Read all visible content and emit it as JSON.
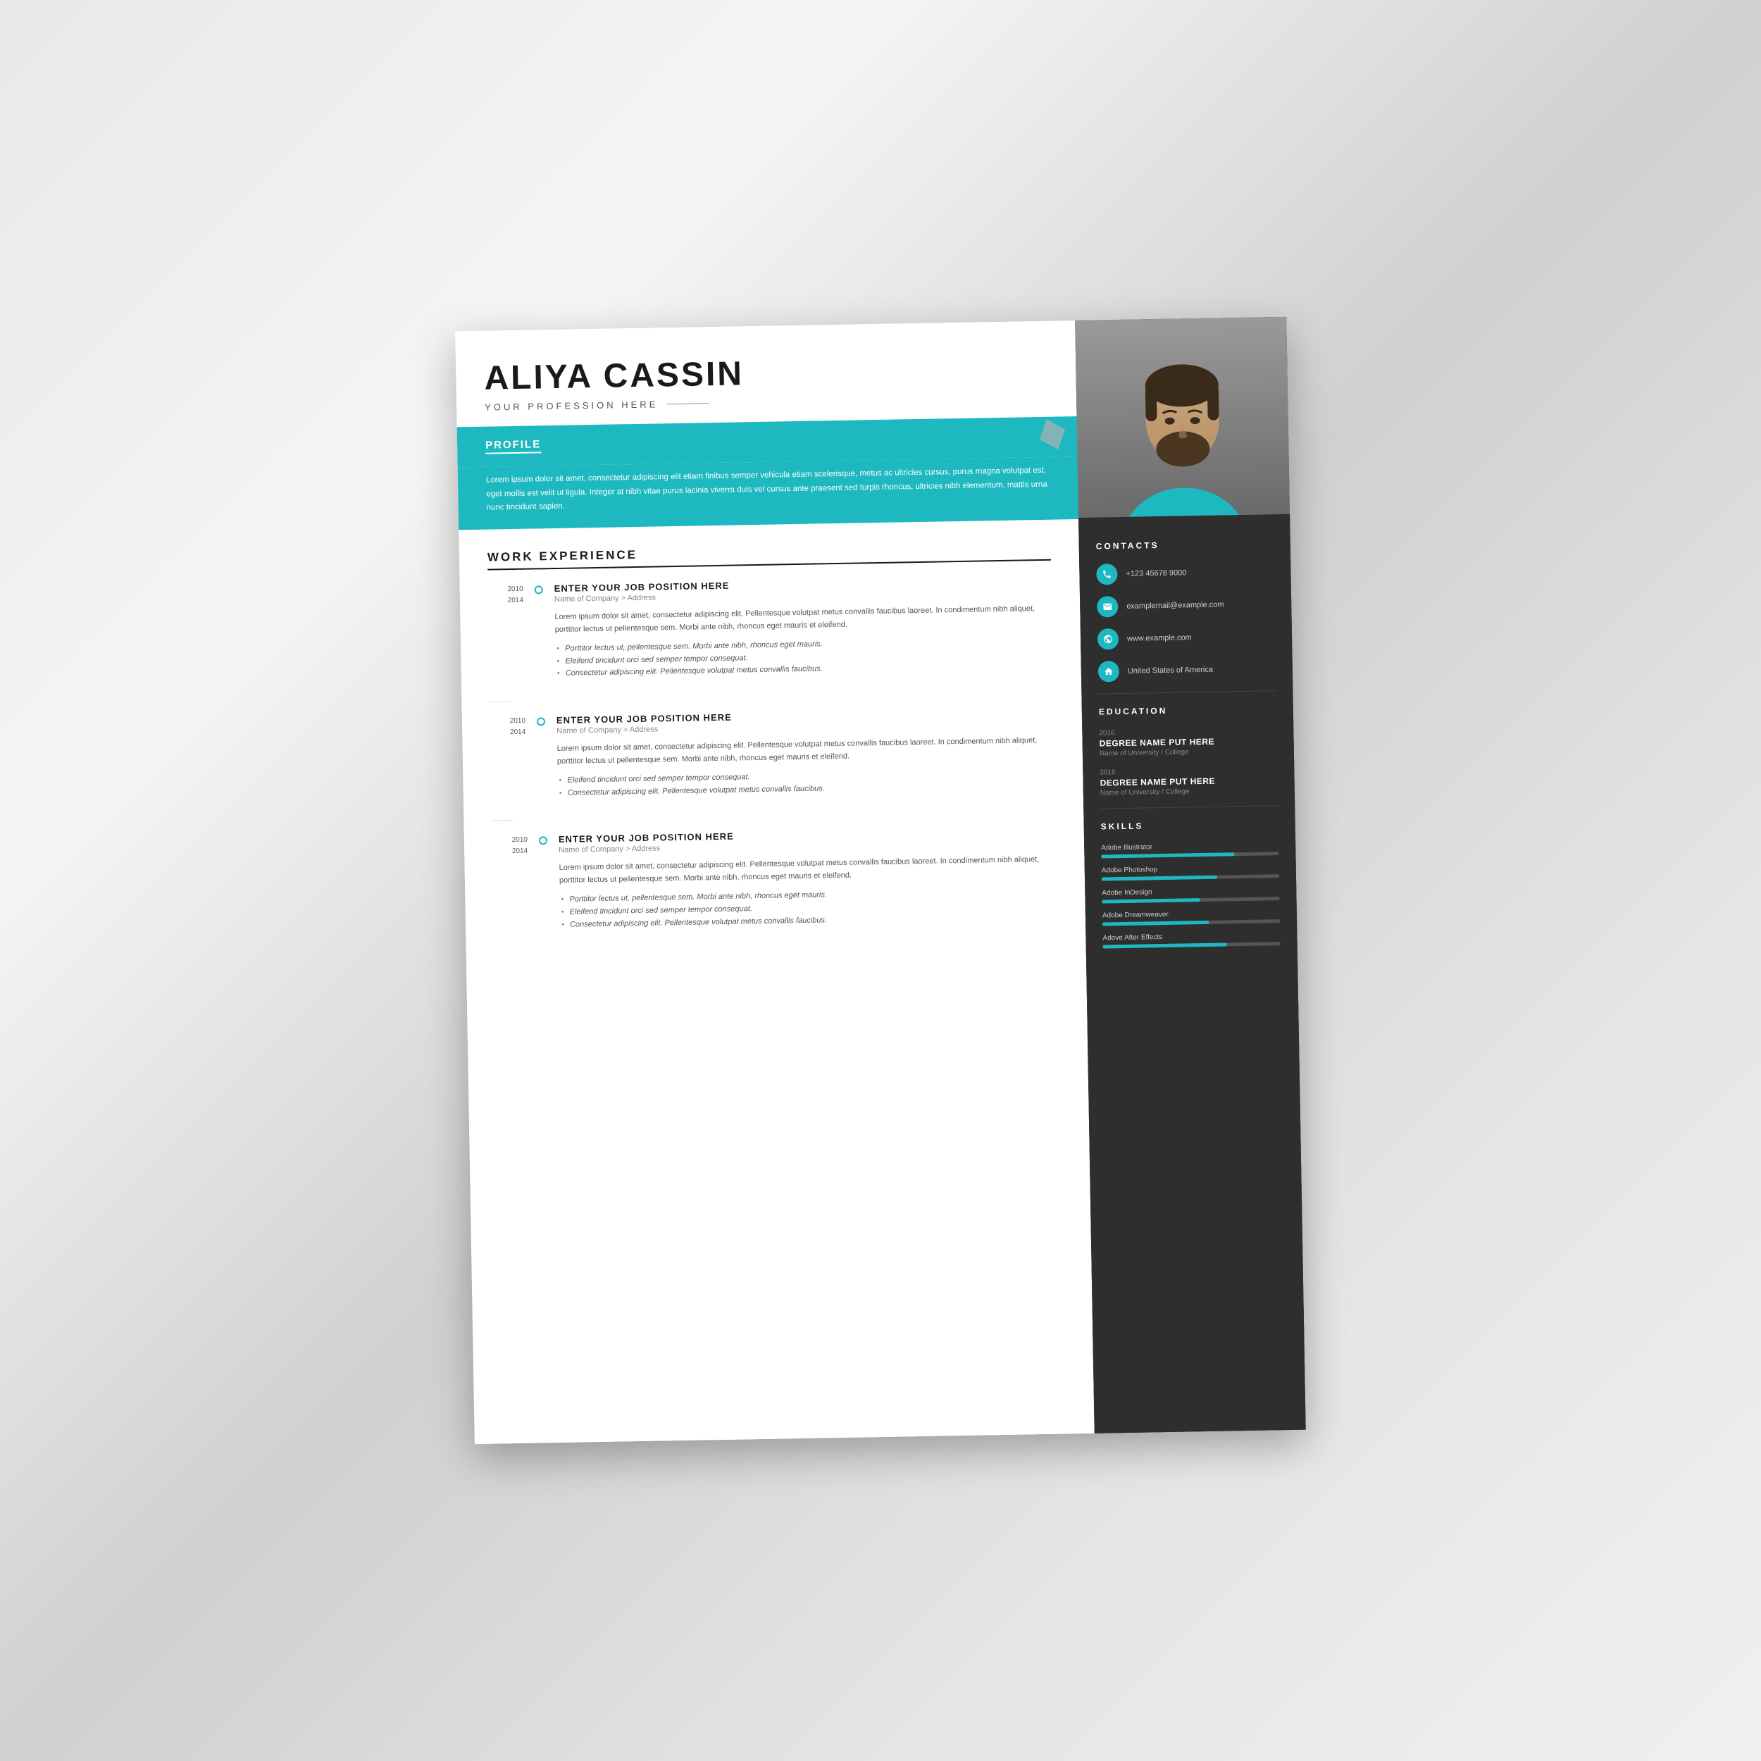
{
  "background": {
    "color": "#d8d8d8"
  },
  "resume": {
    "name": "ALIYA CASSIN",
    "profession": "YOUR PROFESSION HERE",
    "profile": {
      "label": "PROFILE",
      "text": "Lorem ipsum dolor sit amet, consectetur adipiscing elit etiam finibus semper vehicula etiam scelerisque, metus ac ultricies cursus, purus magna volutpat est, eget mollis est velit ut ligula. Integer at nibh vitae purus lacinia viverra duis vel cursus ante praesent sed turpis rhoncus, ultricies nibh elementum, mattis urna nunc tincidunt sapien."
    },
    "workExperience": {
      "sectionTitle": "WORK EXPERIENCE",
      "entries": [
        {
          "yearStart": "2010",
          "yearEnd": "2014",
          "jobTitle": "ENTER YOUR JOB POSITION HERE",
          "company": "Name of Company > Address",
          "description": "Lorem ipsum dolor sit amet, consectetur adipiscing elit. Pellentesque volutpat metus convallis faucibus laoreet. In condimentum nibh aliquet, porttitor lectus ut pellentesque sem. Morbi ante nibh, rhoncus eget mauris et eleifend.",
          "bullets": [
            "Porttitor lectus ut, pellentesque sem. Morbi ante nibh, rhoncus eget mauris.",
            "Eleifend tincidunt orci sed semper tempor consequat.",
            "Consectetur adipiscing elit. Pellentesque volutpat metus convallis faucibus."
          ]
        },
        {
          "yearStart": "2010",
          "yearEnd": "2014",
          "jobTitle": "ENTER YOUR JOB POSITION HERE",
          "company": "Name of Company > Address",
          "description": "Lorem ipsum dolor sit amet, consectetur adipiscing elit. Pellentesque volutpat metus convallis faucibus laoreet. In condimentum nibh aliquet, porttitor lectus ut pellentesque sem. Morbi ante nibh, rhoncus eget mauris et eleifend.",
          "bullets": [
            "Eleifend tincidunt orci sed semper tempor consequat.",
            "Consectetur adipiscing elit. Pellentesque volutpat metus convallis faucibus."
          ]
        },
        {
          "yearStart": "2010",
          "yearEnd": "2014",
          "jobTitle": "ENTER YOUR JOB POSITION HERE",
          "company": "Name of Company > Address",
          "description": "Lorem ipsum dolor sit amet, consectetur adipiscing elit. Pellentesque volutpat metus convallis faucibus laoreet. In condimentum nibh aliquet, porttitor lectus ut pellentesque sem. Morbi ante nibh, rhoncus eget mauris et eleifend.",
          "bullets": [
            "Porttitor lectus ut, pellentesque sem. Morbi ante nibh, rhoncus eget mauris.",
            "Eleifend tincidunt orci sed semper tempor consequat.",
            "Consectetur adipiscing elit. Pellentesque volutpat metus convallis faucibus."
          ]
        }
      ]
    },
    "contacts": {
      "sectionTitle": "CONTACTS",
      "phone": "+123 45678 9000",
      "email": "examplemail@example.com",
      "website": "www.example.com",
      "location": "United States of America"
    },
    "education": {
      "sectionTitle": "EDUCATION",
      "entries": [
        {
          "year": "2016",
          "degree": "DEGREE NAME PUT HERE",
          "school": "Name of University / College"
        },
        {
          "year": "2016",
          "degree": "DEGREE NAME PUT HERE",
          "school": "Name of University / College"
        }
      ]
    },
    "skills": {
      "sectionTitle": "SKILLS",
      "entries": [
        {
          "name": "Adobe Illustrator",
          "percent": 75
        },
        {
          "name": "Adobe Photoshop",
          "percent": 65
        },
        {
          "name": "Adobe InDesign",
          "percent": 55
        },
        {
          "name": "Adobe Dreamweaver",
          "percent": 60
        },
        {
          "name": "Adove After Effects",
          "percent": 70
        }
      ]
    }
  }
}
